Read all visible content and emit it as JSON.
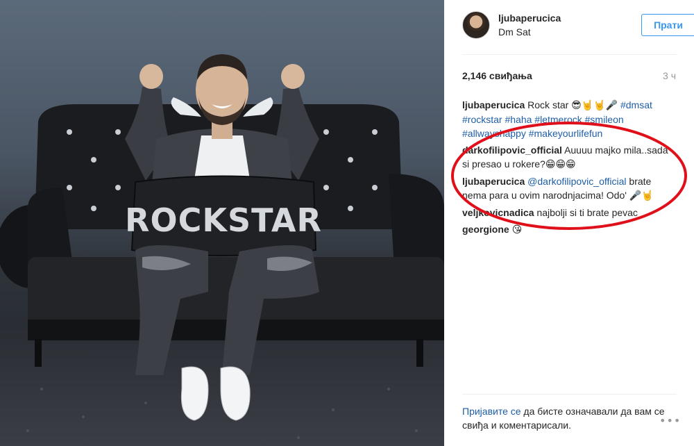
{
  "post": {
    "username": "ljubaperucica",
    "location": "Dm Sat",
    "follow_label": "Прати",
    "likes": "2,146 свиђања",
    "time_ago": "3 ч"
  },
  "caption": {
    "user": "ljubaperucica",
    "text": "Rock star ",
    "emoji": "😎🤘🤘🎤",
    "hashtags": "#dmsat #rockstar #haha #letmerock #smileon #allwayshappy #makeyourlifefun"
  },
  "comments": [
    {
      "user": "darkofilipovic_official",
      "text": "Auuuu majko mila..sada si presao u rokere?",
      "emoji": "😁😁😁"
    },
    {
      "user": "ljubaperucica",
      "mention": "@darkofilipovic_official",
      "text": " brate nema para u ovim narodnjacima! Odo' ",
      "emoji": "🎤🤘"
    },
    {
      "user": "veljkovicnadica",
      "text": "najbolji si ti brate pevac"
    },
    {
      "user": "georgione",
      "emoji": "😘"
    }
  ],
  "footer": {
    "login_link": "Пријавите се",
    "login_text": " да бисте означавали да вам се свиђа и коментарисали.",
    "more_icon": "ellipsis-icon"
  },
  "photo": {
    "pillow_text": "ROCKSTAR"
  },
  "colors": {
    "accent": "#3897f0",
    "link": "#1e5ea8",
    "annotation": "#e0101a"
  }
}
